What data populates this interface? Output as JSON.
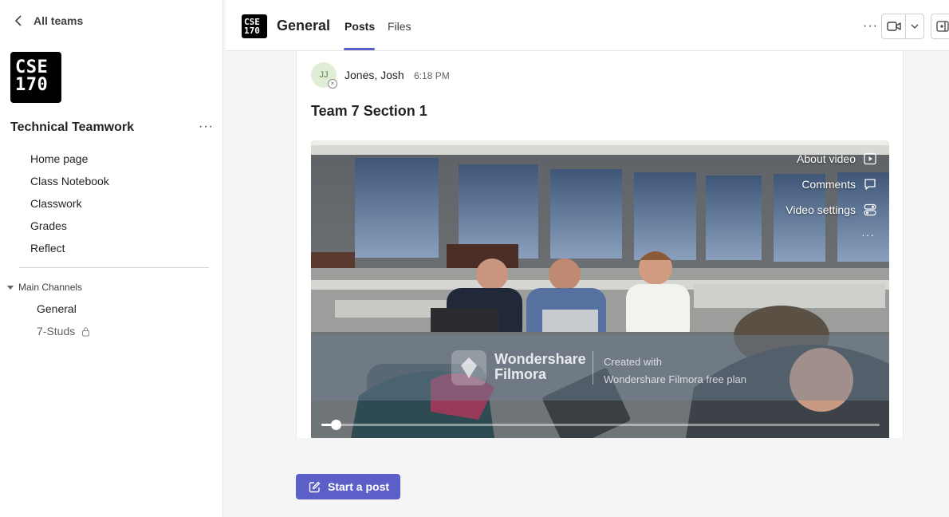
{
  "sidebar": {
    "back_label": "All teams",
    "team_logo_lines": [
      "CSE",
      "170"
    ],
    "team_name": "Technical Teamwork",
    "nav_items": [
      {
        "label": "Home page"
      },
      {
        "label": "Class Notebook"
      },
      {
        "label": "Classwork"
      },
      {
        "label": "Grades"
      },
      {
        "label": "Reflect"
      }
    ],
    "section_title": "Main Channels",
    "channels": [
      {
        "label": "General"
      },
      {
        "label": "7-Studs"
      }
    ]
  },
  "header": {
    "logo_lines": [
      "CSE",
      "170"
    ],
    "title": "General",
    "tabs": [
      {
        "label": "Posts",
        "active": true
      },
      {
        "label": "Files",
        "active": false
      }
    ]
  },
  "post": {
    "avatar_initials": "JJ",
    "author": "Jones, Josh",
    "time": "6:18 PM",
    "title": "Team 7 Section 1",
    "video": {
      "menu": [
        {
          "label": "About video",
          "icon": "play-square-icon"
        },
        {
          "label": "Comments",
          "icon": "comment-icon"
        },
        {
          "label": "Video settings",
          "icon": "settings-toggle-icon"
        }
      ],
      "watermark_brand_line1": "Wondershare",
      "watermark_brand_line2": "Filmora",
      "watermark_note_line1": "Created with",
      "watermark_note_line2": "Wondershare Filmora free plan",
      "progress": 0.025
    }
  },
  "composer": {
    "start_post_label": "Start a post"
  },
  "colors": {
    "accent": "#5b5fc7",
    "sidebar_bg": "#ffffff",
    "page_bg": "#f5f5f5"
  }
}
